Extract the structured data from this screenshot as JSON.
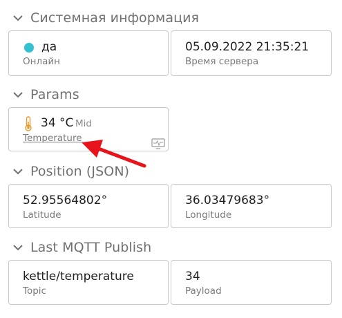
{
  "sections": {
    "system": {
      "title": "Системная информация",
      "status": {
        "value": "да",
        "label": "Онлайн",
        "dot_color": "#35c1cf"
      },
      "server_time": {
        "value": "05.09.2022 21:35:21",
        "label": "Время сервера"
      }
    },
    "params": {
      "title": "Params",
      "temperature": {
        "value": "34 °C",
        "note": "Mid",
        "label": "Temperature",
        "icon": "thermometer-icon"
      }
    },
    "position": {
      "title": "Position (JSON)",
      "latitude": {
        "value": "52.95564802°",
        "label": "Latitude"
      },
      "longitude": {
        "value": "36.03479683°",
        "label": "Longitude"
      }
    },
    "mqtt": {
      "title": "Last MQTT Publish",
      "topic": {
        "value": "kettle/temperature",
        "label": "Topic"
      },
      "payload": {
        "value": "34",
        "label": "Payload"
      }
    }
  },
  "colors": {
    "accent": "#35c1cf",
    "annotation_arrow": "#e8141b",
    "thermometer": "#e39a2e"
  }
}
